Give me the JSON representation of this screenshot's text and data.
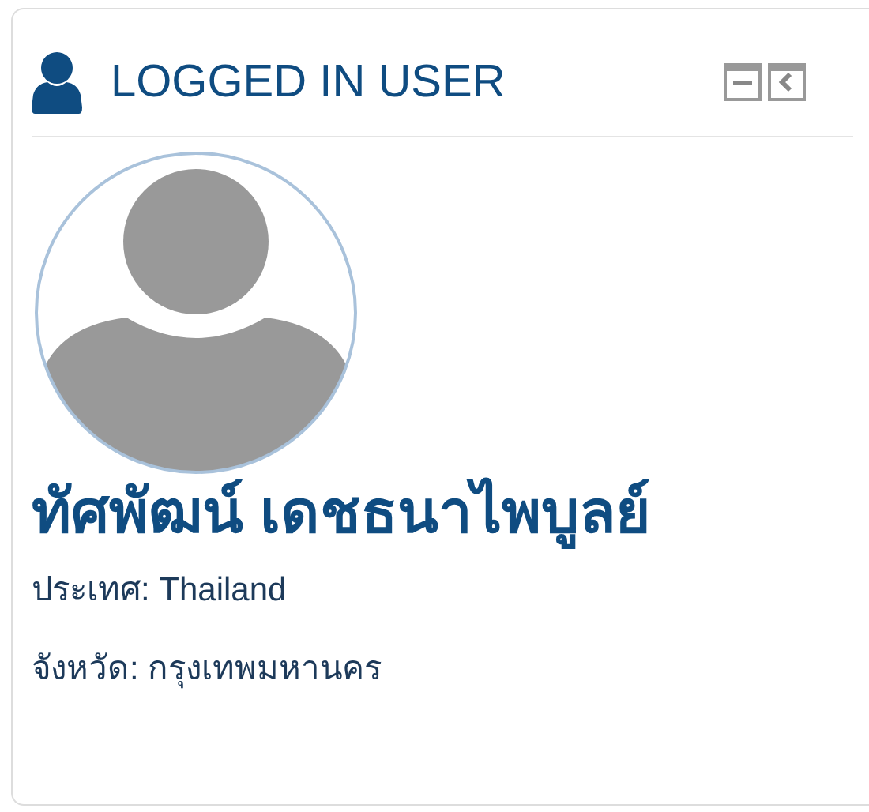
{
  "block": {
    "title": "LOGGED IN USER",
    "controls": [
      {
        "kind": "collapse"
      },
      {
        "kind": "dock"
      }
    ]
  },
  "user": {
    "name": "ทัศพัฒน์ เดชธนาไพบูลย์",
    "fields": [
      "ประเทศ: Thailand",
      "จังหวัด: กรุงเทพมหานคร"
    ]
  }
}
